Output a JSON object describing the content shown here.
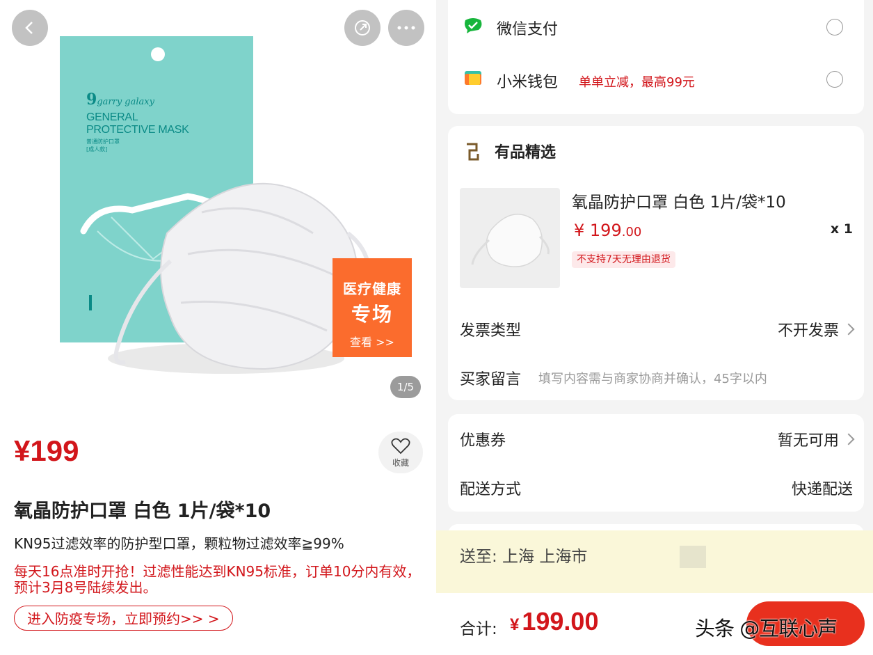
{
  "gallery": {
    "pager": "1/5",
    "badge": {
      "line1": "医疗健康",
      "line2": "专场",
      "line3": "查看 >>"
    },
    "package": {
      "brand": "garry galaxy",
      "title": "GENERAL PROTECTIVE MASK",
      "subtitle": "普通防护口罩",
      "note": "[成人款]"
    }
  },
  "product": {
    "price": "¥199",
    "favorite_label": "收藏",
    "title": "氧晶防护口罩 白色 1片/袋*10",
    "description": "KN95过滤效率的防护型口罩，颗粒物过滤效率≧99%",
    "promo": "每天16点准时开抢！过滤性能达到KN95标准，订单10分内有效，预计3月8号陆续发出。",
    "cta": "进入防疫专场，立即预约>> >"
  },
  "payment": {
    "options": [
      {
        "label": "微信支付",
        "note": ""
      },
      {
        "label": "小米钱包",
        "note": "单单立减，最高99元"
      }
    ]
  },
  "order": {
    "store": "有品精选",
    "item": {
      "title": "氧晶防护口罩 白色 1片/袋*10",
      "price_int": "¥ 199",
      "price_dec": ".00",
      "qty": "x 1",
      "tag": "不支持7天无理由退货"
    },
    "invoice_label": "发票类型",
    "invoice_value": "不开发票",
    "message_label": "买家留言",
    "message_placeholder": "填写内容需与商家协商并确认，45字以内"
  },
  "coupon": {
    "label": "优惠券",
    "value": "暂无可用"
  },
  "delivery": {
    "label": "配送方式",
    "value": "快递配送"
  },
  "shipping": {
    "to": "送至: 上海 上海市"
  },
  "footer": {
    "total_label": "合计:",
    "total_yen": "¥",
    "total_value": "199.00",
    "watermark": "头条 @互联心声"
  },
  "colors": {
    "accent": "#d2161b",
    "wechat": "#17b53c",
    "submit": "#e8301e",
    "badge": "#fb6c2d"
  }
}
